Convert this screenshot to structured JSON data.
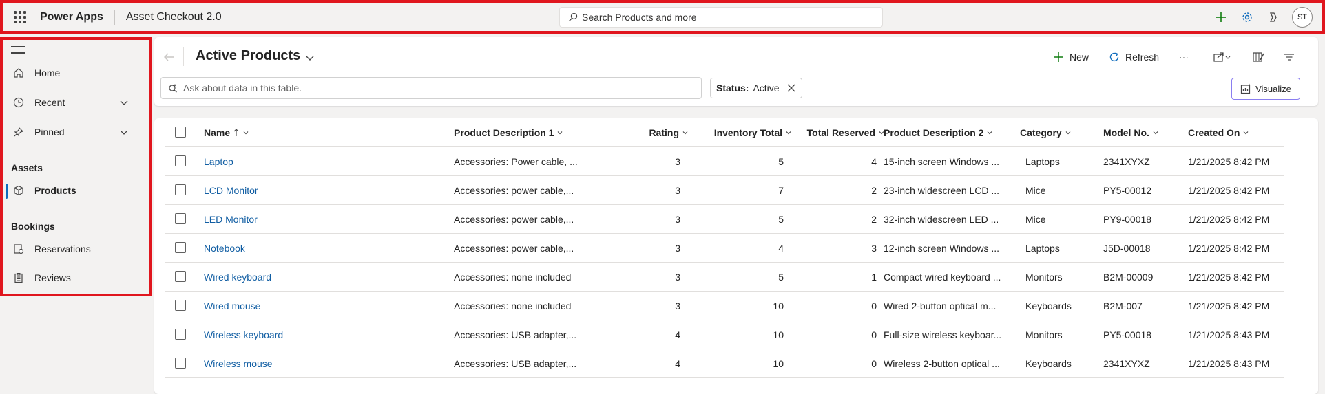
{
  "topbar": {
    "app_name": "Power Apps",
    "app_title": "Asset Checkout 2.0",
    "search_placeholder": "Search Products and more",
    "avatar_initials": "ST"
  },
  "sidebar": {
    "items": [
      {
        "label": "Home",
        "icon": "home-icon"
      },
      {
        "label": "Recent",
        "icon": "clock-icon"
      },
      {
        "label": "Pinned",
        "icon": "pin-icon"
      }
    ],
    "sections": [
      {
        "title": "Assets",
        "items": [
          {
            "label": "Products",
            "icon": "cube-icon"
          }
        ]
      },
      {
        "title": "Bookings",
        "items": [
          {
            "label": "Reservations",
            "icon": "reservations-icon"
          },
          {
            "label": "Reviews",
            "icon": "clipboard-icon"
          }
        ]
      }
    ]
  },
  "view": {
    "title": "Active Products",
    "new_label": "New",
    "refresh_label": "Refresh",
    "more_label": "···",
    "copilot_placeholder": "Ask about data in this table.",
    "filter_key": "Status:",
    "filter_value": "Active",
    "visualize_label": "Visualize"
  },
  "table": {
    "columns": [
      "Name",
      "Product Description 1",
      "Rating",
      "Inventory Total",
      "Total Reserved",
      "Product Description 2",
      "Category",
      "Model No.",
      "Created On"
    ],
    "rows": [
      [
        "Laptop",
        "Accessories: Power cable, ...",
        "3",
        "5",
        "4",
        "15-inch screen Windows ...",
        "Laptops",
        "2341XYXZ",
        "1/21/2025 8:42 PM"
      ],
      [
        "LCD Monitor",
        "Accessories: power cable,...",
        "3",
        "7",
        "2",
        "23-inch widescreen LCD ...",
        "Mice",
        "PY5-00012",
        "1/21/2025 8:42 PM"
      ],
      [
        "LED Monitor",
        "Accessories: power cable,...",
        "3",
        "5",
        "2",
        "32-inch widescreen LED ...",
        "Mice",
        "PY9-00018",
        "1/21/2025 8:42 PM"
      ],
      [
        "Notebook",
        "Accessories: power cable,...",
        "3",
        "4",
        "3",
        "12-inch screen Windows ...",
        "Laptops",
        "J5D-00018",
        "1/21/2025 8:42 PM"
      ],
      [
        "Wired keyboard",
        "Accessories: none included",
        "3",
        "5",
        "1",
        "Compact wired keyboard ...",
        "Monitors",
        "B2M-00009",
        "1/21/2025 8:42 PM"
      ],
      [
        "Wired mouse",
        "Accessories: none included",
        "3",
        "10",
        "0",
        "Wired 2-button optical m...",
        "Keyboards",
        "B2M-007",
        "1/21/2025 8:42 PM"
      ],
      [
        "Wireless keyboard",
        "Accessories: USB adapter,...",
        "4",
        "10",
        "0",
        "Full-size wireless keyboar...",
        "Monitors",
        "PY5-00018",
        "1/21/2025 8:43 PM"
      ],
      [
        "Wireless mouse",
        "Accessories: USB adapter,...",
        "4",
        "10",
        "0",
        "Wireless 2-button optical ...",
        "Keyboards",
        "2341XYXZ",
        "1/21/2025 8:43 PM"
      ]
    ]
  },
  "colors": {
    "highlight_border": "#e0161e",
    "link": "#115ea3",
    "accent_green": "#107c10",
    "accent_blue": "#0f6cbd"
  }
}
